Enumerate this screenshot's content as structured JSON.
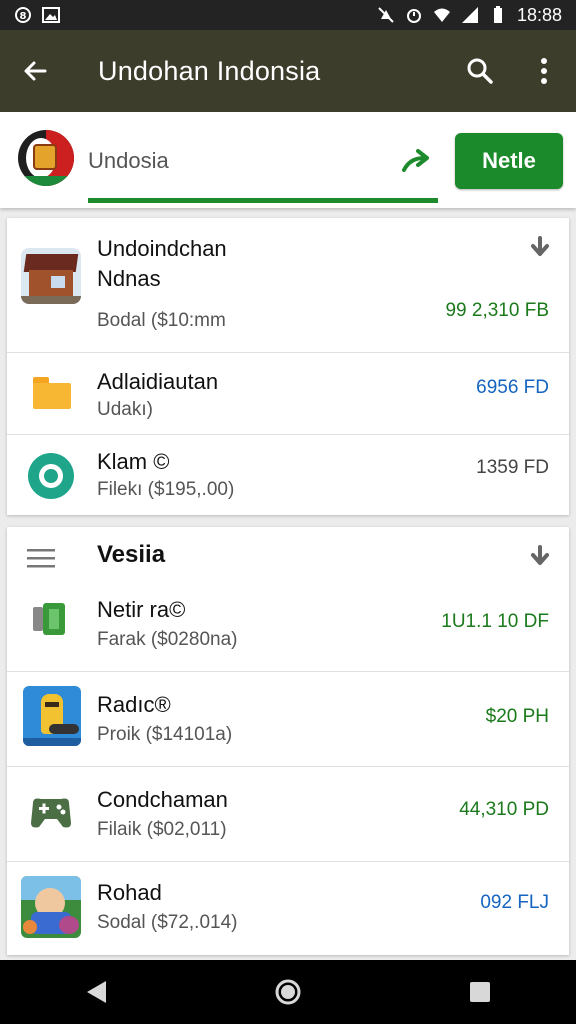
{
  "status_bar": {
    "left_icons": [
      "notification-icon",
      "image-icon"
    ],
    "time": "18:88"
  },
  "app_bar": {
    "title": "Undohan Indonsia"
  },
  "search": {
    "query": "Undosia",
    "next_label": "Netle"
  },
  "section1": {
    "items": [
      {
        "title": "Undoindchan",
        "title2": "Ndnas",
        "sub": "Bodal ($10:mm",
        "price": "99 2,310 FB",
        "price_color": "green",
        "icon": "house-icon"
      },
      {
        "title": "Adlaidiautan",
        "sub": "Udakı)",
        "price": "6956 FD",
        "price_color": "blue",
        "icon": "folder-icon"
      },
      {
        "title": "Klam ©",
        "sub": "Filekı ($195,.00)",
        "price": "1359 FD",
        "price_color": "gray",
        "icon": "ring-icon"
      }
    ]
  },
  "section2": {
    "header": "Vesiia",
    "items": [
      {
        "title": "Netir ra©",
        "sub": "Farak ($0280na)",
        "price": "1U1.1 10 DF",
        "price_color": "green",
        "icon": "device-icon"
      },
      {
        "title": "Radıc®",
        "sub": "Proik ($14101a)",
        "price": "$20 PH",
        "price_color": "green",
        "icon": "cartoon-icon"
      },
      {
        "title": "Condchaman",
        "sub": "Filaik ($02,011)",
        "price": "44,310 PD",
        "price_color": "green",
        "icon": "gamepad-icon"
      },
      {
        "title": "Rohad",
        "sub": "Sodal ($72,.014)",
        "price": "092 FLJ",
        "price_color": "blue",
        "icon": "game-art-icon"
      }
    ]
  },
  "colors": {
    "appbar": "#3d3d2c",
    "accent_green": "#1a8a2a",
    "price_blue": "#1565c0"
  }
}
